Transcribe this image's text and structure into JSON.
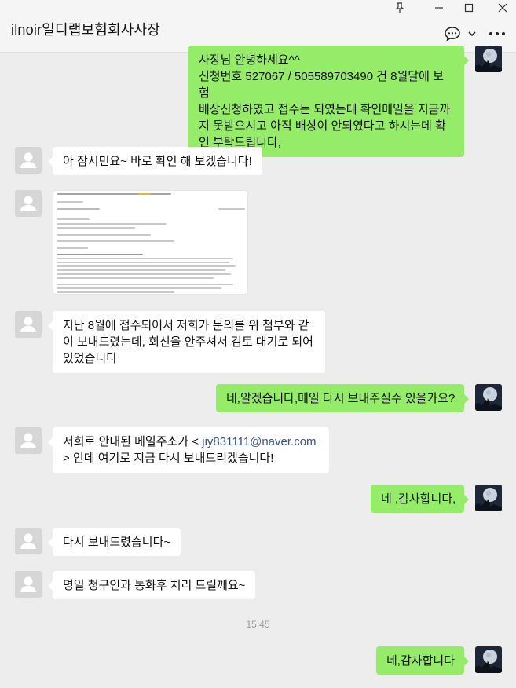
{
  "window": {
    "title": "ilnoir일디랩보험회사사장",
    "controls": {
      "pin": "pin-icon",
      "minimize": "minimize-icon",
      "maximize": "maximize-icon",
      "close": "close-icon"
    },
    "header_icons": [
      "chat-bubble-icon",
      "chevron-down-icon",
      "more-icon"
    ]
  },
  "messages": [
    {
      "id": "m1",
      "side": "right",
      "lines": [
        "사장님 안녕하세요^^",
        "신청번호 527067 / 505589703490 건 8월달에 보험",
        "배상신청하였고 접수는 되였는데 확인메일을 지금까",
        "지 못받으시고 아직 배상이 안되였다고 하시는데 확",
        "인 부탁드립니다,"
      ]
    },
    {
      "id": "m2",
      "side": "left",
      "text": "아 잠시민요~ 바로 확인 해 보겠습니다!"
    },
    {
      "id": "m3",
      "side": "left",
      "type": "image",
      "image_label": "email-screenshot"
    },
    {
      "id": "m4",
      "side": "left",
      "lines": [
        "지난 8월에 접수되어서 저희가 문의를 위 첨부와 같",
        "이 보내드렸는데, 회신을 안주셔서 검토 대기로 되어",
        "있었습니다"
      ]
    },
    {
      "id": "m5",
      "side": "right",
      "text": "네,알겠습니다,메일 다시 보내주실수 있을가요?"
    },
    {
      "id": "m6",
      "side": "left",
      "line1_prefix": "저희로 안내된 메일주소가 < ",
      "email": "jiy831111@naver.com",
      "line2": "> 인데 여기로 지금 다시 보내드리겠습니다!"
    },
    {
      "id": "m7",
      "side": "right",
      "text": "네 ,감사합니다,"
    },
    {
      "id": "m8",
      "side": "left",
      "text": "다시 보내드렸습니다~"
    },
    {
      "id": "m9",
      "side": "left",
      "text": "명일 청구인과 통화후 처리 드릴께요~"
    },
    {
      "id": "m10",
      "side": "right",
      "text": "네,감사합니다"
    }
  ],
  "timestamp": "15:45",
  "colors": {
    "my_bubble": "#95ec69",
    "their_bubble": "#ffffff",
    "background": "#ededed",
    "email_link": "#37528c"
  }
}
